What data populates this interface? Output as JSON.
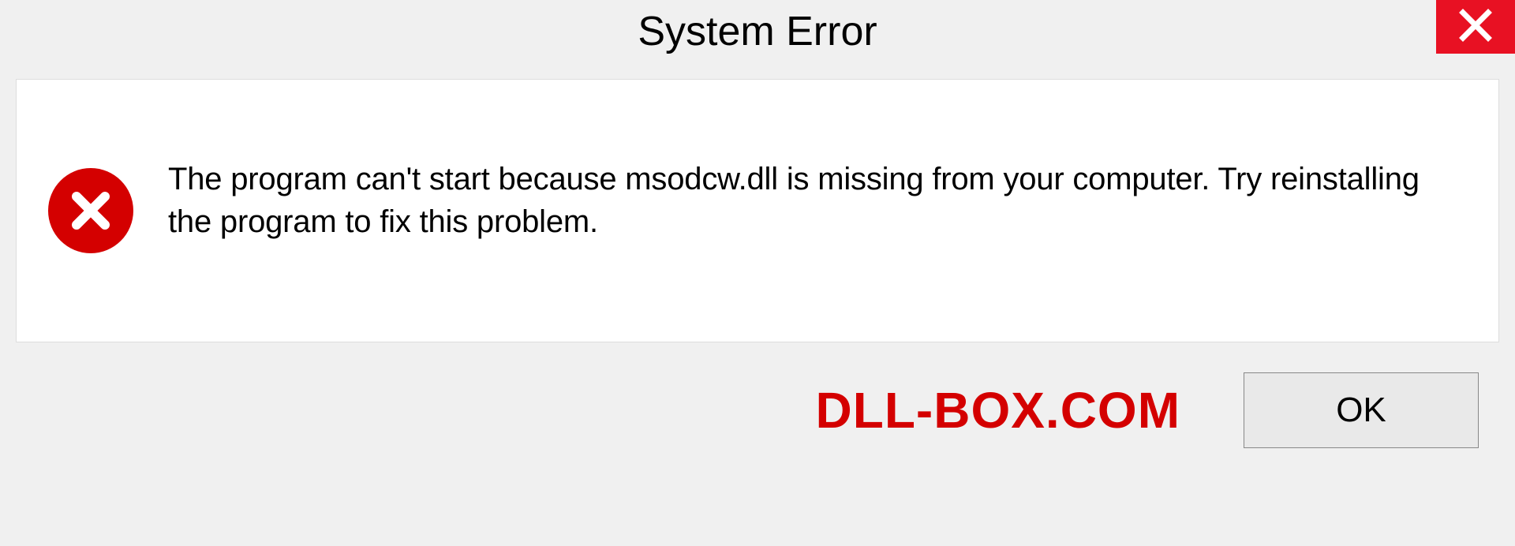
{
  "dialog": {
    "title": "System Error",
    "message": "The program can't start because msodcw.dll is missing from your computer. Try reinstalling the program to fix this problem.",
    "ok_label": "OK"
  },
  "brand": "DLL-BOX.COM",
  "colors": {
    "close_red": "#e81123",
    "error_red": "#d40000"
  }
}
